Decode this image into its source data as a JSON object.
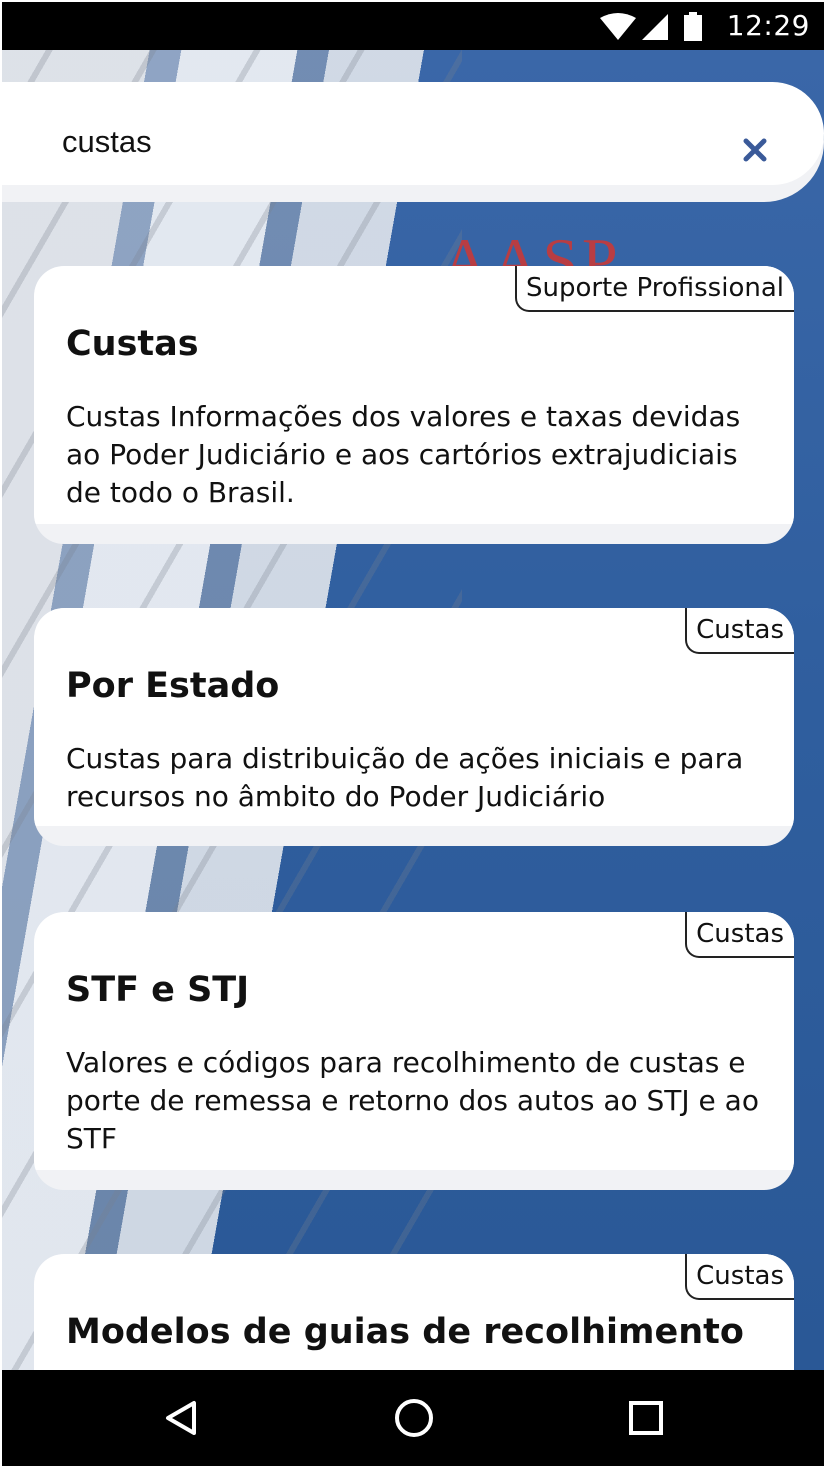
{
  "status_bar": {
    "time": "12:29",
    "icons": [
      "wifi-icon",
      "signal-icon",
      "battery-icon"
    ]
  },
  "background": {
    "logo_text": "AASP"
  },
  "search": {
    "query": "custas",
    "clear_icon": "close-icon",
    "accent_color": "#3a5a99"
  },
  "results": [
    {
      "tag": "Suporte Profissional",
      "title": "Custas",
      "description": "Custas Informações dos valores e taxas devidas ao Poder Judiciário e aos cartórios extrajudiciais de todo o Brasil."
    },
    {
      "tag": "Custas",
      "title": "Por Estado",
      "description": "Custas para distribuição de ações iniciais e para recursos no âmbito do Poder Judiciário"
    },
    {
      "tag": "Custas",
      "title": "STF e STJ",
      "description": "Valores e códigos para recolhimento de custas e porte de remessa e retorno dos autos ao STJ e ao STF"
    },
    {
      "tag": "Custas",
      "title": "Modelos de guias de recolhimento",
      "description": ""
    }
  ],
  "nav_bar": {
    "buttons": [
      "back-icon",
      "home-icon",
      "recents-icon"
    ]
  }
}
